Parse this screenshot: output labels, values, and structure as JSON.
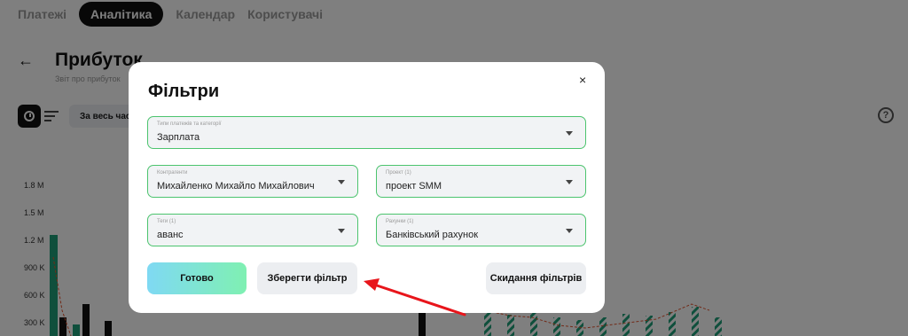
{
  "nav": {
    "tabs": [
      {
        "label": "Платежі"
      },
      {
        "label": "Аналітика"
      },
      {
        "label": "Календар"
      },
      {
        "label": "Користувачі"
      }
    ]
  },
  "page": {
    "title": "Прибуток",
    "subtitle": "Звіт про прибуток",
    "period_button": "За весь час"
  },
  "chart": {
    "y_ticks": [
      "1.8 M",
      "1.5 M",
      "1.2 M",
      "900 K",
      "600 K",
      "300 K"
    ]
  },
  "modal": {
    "title": "Фільтри",
    "close": "×",
    "fields": {
      "payment_types": {
        "label": "Типи платежів та категорії",
        "value": "Зарплата"
      },
      "counterparties": {
        "label": "Контрагенти",
        "value": "Михайленко Михайло Михайлович"
      },
      "project": {
        "label": "Проект (1)",
        "value": "проект SMM"
      },
      "tags": {
        "label": "Теги (1)",
        "value": "аванс"
      },
      "accounts": {
        "label": "Рахунки (1)",
        "value": "Банківський рахунок"
      }
    },
    "buttons": {
      "done": "Готово",
      "save": "Зберегти фільтр",
      "reset": "Скидання фільтрів"
    }
  },
  "colors": {
    "accent_green": "#4cc46e",
    "annotation_red": "#e8151b",
    "bar_green": "#1e9e78"
  }
}
